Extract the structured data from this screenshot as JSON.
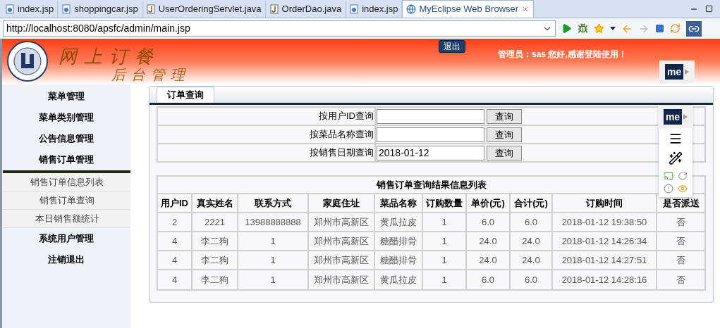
{
  "editor_tabs": [
    {
      "label": "index.jsp",
      "kind": "jsp",
      "selected": false
    },
    {
      "label": "shoppingcar.jsp",
      "kind": "jsp",
      "selected": false
    },
    {
      "label": "UserOrderingServlet.java",
      "kind": "java",
      "selected": false
    },
    {
      "label": "OrderDao.java",
      "kind": "java",
      "selected": false
    },
    {
      "label": "index.jsp",
      "kind": "jsp",
      "selected": false
    },
    {
      "label": "MyEclipse Web Browser",
      "kind": "browser",
      "selected": true
    }
  ],
  "address_bar": {
    "value": "http://localhost:8080/apsfc/admin/main.jsp"
  },
  "header": {
    "title": "网上订餐",
    "subtitle": "后台管理",
    "logout_button": "退出",
    "greeting": "管理员：sas 您好,感谢登陆使用！",
    "badge": "me"
  },
  "sidebar": [
    {
      "label": "菜单管理",
      "expanded": false
    },
    {
      "label": "菜单类别管理",
      "expanded": false
    },
    {
      "label": "公告信息管理",
      "expanded": false
    },
    {
      "label": "销售订单管理",
      "expanded": true,
      "children": [
        {
          "label": "销售订单信息列表"
        },
        {
          "label": "销售订单查询"
        },
        {
          "label": "本日销售额统计"
        }
      ]
    },
    {
      "label": "系统用户管理",
      "expanded": false
    },
    {
      "label": "注销退出",
      "expanded": false
    }
  ],
  "tabs": [
    {
      "label": "订单查询",
      "selected": true
    }
  ],
  "search_rows": [
    {
      "label": "按用户ID查询",
      "button": "查询"
    },
    {
      "label": "按菜品名称查询",
      "button": "查询"
    },
    {
      "label": "按销售日期查询",
      "value": "2018-01-12",
      "button": "查询"
    }
  ],
  "results": {
    "title": "销售订单查询结果信息列表",
    "columns": [
      "用户ID",
      "真实姓名",
      "联系方式",
      "家庭住址",
      "菜品名称",
      "订购数量",
      "单价(元)",
      "合计(元)",
      "订购时间",
      "是否派送"
    ],
    "rows": [
      [
        "2",
        "2221",
        "13988888888",
        "郑州市高新区",
        "黄瓜拉皮",
        "1",
        "6.0",
        "6.0",
        "2018-01-12 19:38:50",
        "否"
      ],
      [
        "4",
        "李二狗",
        "1",
        "郑州市高新区",
        "糖醋排骨",
        "1",
        "24.0",
        "24.0",
        "2018-01-12 14:26:34",
        "否"
      ],
      [
        "4",
        "李二狗",
        "1",
        "郑州市高新区",
        "糖醋排骨",
        "1",
        "24.0",
        "24.0",
        "2018-01-12 14:27:51",
        "否"
      ],
      [
        "4",
        "李二狗",
        "1",
        "郑州市高新区",
        "黄瓜拉皮",
        "1",
        "6.0",
        "6.0",
        "2018-01-12 14:28:16",
        "否"
      ]
    ]
  },
  "side_panel": {
    "badge": "me"
  }
}
